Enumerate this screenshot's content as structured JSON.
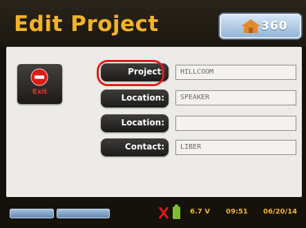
{
  "header": {
    "title": "Edit Project",
    "brand_icon": "house-icon",
    "brand_text": "360"
  },
  "exit": {
    "label": "Exit",
    "icon": "no-entry-icon",
    "icon_color": "#e01a17"
  },
  "form": {
    "rows": [
      {
        "label": "Project:",
        "value": "HILLCOOM",
        "highlighted": true
      },
      {
        "label": "Location:",
        "value": "SPEAKER",
        "highlighted": false
      },
      {
        "label": "Location:",
        "value": "",
        "highlighted": false
      },
      {
        "label": "Contact:",
        "value": "LIBER",
        "highlighted": false
      }
    ]
  },
  "status_bar": {
    "usb_icon": "usb-disconnected-icon",
    "battery_icon": "battery-icon",
    "voltage": "6.7 V",
    "time": "09:51",
    "date": "06/20/14"
  },
  "colors": {
    "accent": "#f2b32a",
    "highlight": "#e01a17",
    "panel": "#ecebe7"
  }
}
